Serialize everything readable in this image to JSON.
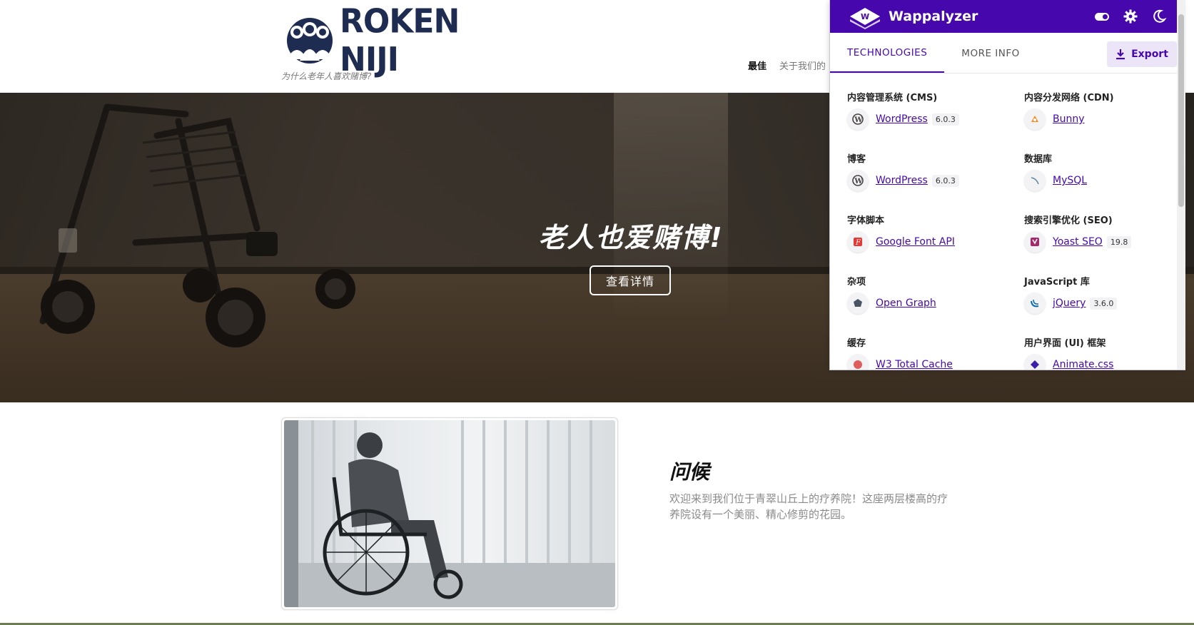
{
  "site": {
    "logo_text": "ROKEN NIJI",
    "tagline": "为什么老年人喜欢赌博?",
    "nav": [
      {
        "label": "最佳",
        "active": true
      },
      {
        "label": "关于我们的",
        "active": false
      }
    ]
  },
  "hero": {
    "title": "老人也爱赌博!",
    "button_label": "查看详情"
  },
  "content": {
    "title": "问候",
    "text": "欢迎来到我们位于青翠山丘上的疗养院！这座两层楼高的疗养院设有一个美丽、精心修剪的花园。"
  },
  "wappalyzer": {
    "brand": "Wappalyzer",
    "header_icons": [
      "toggle-icon",
      "gear-icon",
      "moon-icon"
    ],
    "tabs": [
      {
        "label": "TECHNOLOGIES",
        "active": true
      },
      {
        "label": "MORE INFO",
        "active": false
      }
    ],
    "export_label": "Export",
    "accent": "#4608ad",
    "categories": [
      {
        "title": "内容管理系统 (CMS)",
        "techs": [
          {
            "name": "WordPress",
            "version": "6.0.3",
            "icon": "wordpress-icon"
          }
        ]
      },
      {
        "title": "内容分发网络 (CDN)",
        "techs": [
          {
            "name": "Bunny",
            "version": "",
            "icon": "bunny-icon"
          }
        ]
      },
      {
        "title": "博客",
        "techs": [
          {
            "name": "WordPress",
            "version": "6.0.3",
            "icon": "wordpress-icon"
          }
        ]
      },
      {
        "title": "数据库",
        "techs": [
          {
            "name": "MySQL",
            "version": "",
            "icon": "mysql-icon"
          }
        ]
      },
      {
        "title": "字体脚本",
        "techs": [
          {
            "name": "Google Font API",
            "version": "",
            "icon": "google-font-icon"
          }
        ]
      },
      {
        "title": "搜索引擎优化 (SEO)",
        "techs": [
          {
            "name": "Yoast SEO",
            "version": "19.8",
            "icon": "yoast-icon"
          }
        ]
      },
      {
        "title": "杂项",
        "techs": [
          {
            "name": "Open Graph",
            "version": "",
            "icon": "open-graph-icon"
          }
        ]
      },
      {
        "title": "JavaScript 库",
        "techs": [
          {
            "name": "jQuery",
            "version": "3.6.0",
            "icon": "jquery-icon"
          }
        ]
      },
      {
        "title": "缓存",
        "techs": [
          {
            "name": "W3 Total Cache",
            "version": "",
            "icon": "w3-total-cache-icon"
          }
        ]
      },
      {
        "title": "用户界面 (UI) 框架",
        "techs": [
          {
            "name": "Animate.css",
            "version": "",
            "icon": "animate-css-icon"
          }
        ]
      }
    ]
  }
}
